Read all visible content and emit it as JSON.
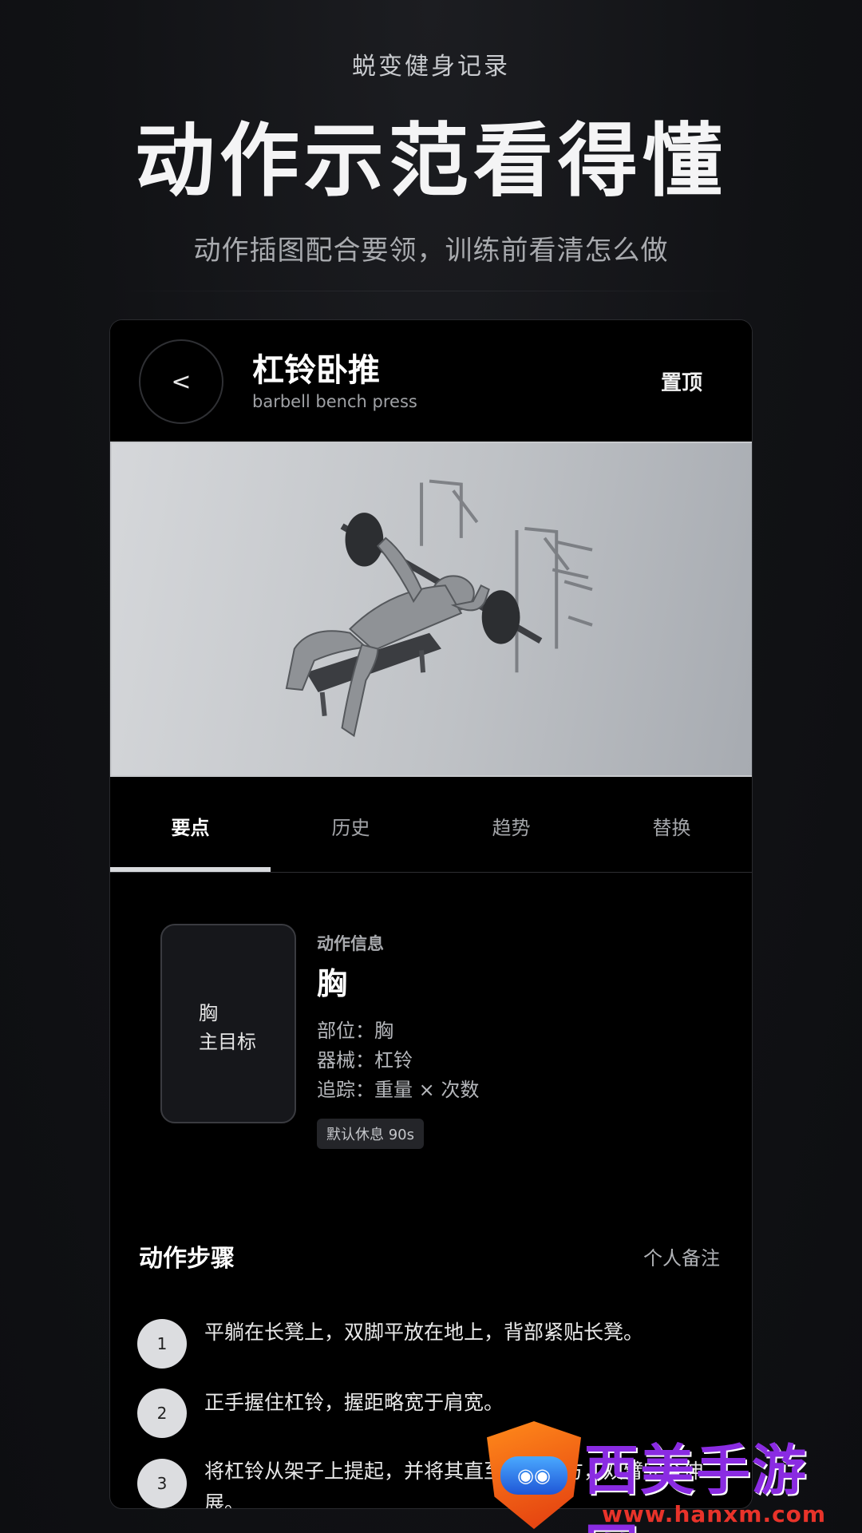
{
  "promo": {
    "subtitle": "蜕变健身记录",
    "title": "动作示范看得懂",
    "caption": "动作插图配合要领，训练前看清怎么做"
  },
  "header": {
    "back_label": "<",
    "exercise_name": "杠铃卧推",
    "exercise_en": "barbell bench press",
    "pin_label": "置顶"
  },
  "tabs": [
    {
      "label": "要点",
      "active": true
    },
    {
      "label": "历史",
      "active": false
    },
    {
      "label": "趋势",
      "active": false
    },
    {
      "label": "替换",
      "active": false
    }
  ],
  "info": {
    "card_line1": "胸",
    "card_line2": "主目标",
    "heading": "动作信息",
    "main": "胸",
    "part": "部位：胸",
    "equipment": "器械：杠铃",
    "tracking": "追踪：重量 × 次数",
    "rest_badge": "默认休息 90s"
  },
  "steps": {
    "title": "动作步骤",
    "notes_label": "个人备注",
    "items": [
      {
        "num": "1",
        "text": "平躺在长凳上，双脚平放在地上，背部紧贴长凳。"
      },
      {
        "num": "2",
        "text": "正手握住杠铃，握距略宽于肩宽。"
      },
      {
        "num": "3",
        "text": "将杠铃从架子上提起，并将其直至胸部上方，双臂完全伸展。"
      }
    ]
  },
  "watermark": {
    "brand": "西美手游网",
    "url": "www.hanxm.com"
  },
  "colors": {
    "background": "#101114",
    "phone_bg": "#000000",
    "tab_indicator": "#d8dadd",
    "step_circle": "#dcdde0"
  }
}
